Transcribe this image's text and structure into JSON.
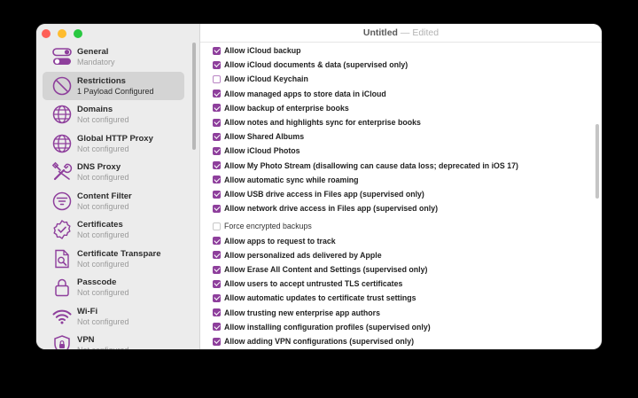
{
  "window": {
    "title": "Untitled",
    "title_sep": "—",
    "edited": "Edited"
  },
  "colors": {
    "accent": "#8e3f9c",
    "sidebar_bg": "#ececec",
    "selected_bg": "#d4d4d4"
  },
  "sidebar": {
    "items": [
      {
        "title": "General",
        "subtitle": "Mandatory",
        "icon": "toggle-icon"
      },
      {
        "title": "Restrictions",
        "subtitle": "1 Payload Configured",
        "icon": "prohibited-icon",
        "selected": true
      },
      {
        "title": "Domains",
        "subtitle": "Not configured",
        "icon": "globe-icon"
      },
      {
        "title": "Global HTTP Proxy",
        "subtitle": "Not configured",
        "icon": "globe-icon"
      },
      {
        "title": "DNS Proxy",
        "subtitle": "Not configured",
        "icon": "tools-icon"
      },
      {
        "title": "Content Filter",
        "subtitle": "Not configured",
        "icon": "filter-icon"
      },
      {
        "title": "Certificates",
        "subtitle": "Not configured",
        "icon": "certificate-badge-icon"
      },
      {
        "title": "Certificate Transpare",
        "subtitle": "Not configured",
        "icon": "document-search-icon"
      },
      {
        "title": "Passcode",
        "subtitle": "Not configured",
        "icon": "lock-icon"
      },
      {
        "title": "Wi-Fi",
        "subtitle": "Not configured",
        "icon": "wifi-icon"
      },
      {
        "title": "VPN",
        "subtitle": "Not configured",
        "icon": "vpn-icon"
      }
    ]
  },
  "options": [
    {
      "label": "Allow iCloud backup",
      "state": "on"
    },
    {
      "label": "Allow iCloud documents & data (supervised only)",
      "state": "on"
    },
    {
      "label": "Allow iCloud Keychain",
      "state": "focus"
    },
    {
      "label": "Allow managed apps to store data in iCloud",
      "state": "on"
    },
    {
      "label": "Allow backup of enterprise books",
      "state": "on"
    },
    {
      "label": "Allow notes and highlights sync for enterprise books",
      "state": "on"
    },
    {
      "label": "Allow Shared Albums",
      "state": "on"
    },
    {
      "label": "Allow iCloud Photos",
      "state": "on"
    },
    {
      "label": "Allow My Photo Stream (disallowing can cause data loss; deprecated in iOS 17)",
      "state": "on"
    },
    {
      "label": "Allow automatic sync while roaming",
      "state": "on"
    },
    {
      "label": "Allow USB drive access in Files app (supervised only)",
      "state": "on"
    },
    {
      "label": "Allow network drive access in Files app (supervised only)",
      "state": "on"
    },
    {
      "label": "Force encrypted backups",
      "state": "off"
    },
    {
      "label": "Allow apps to request to track",
      "state": "on"
    },
    {
      "label": "Allow personalized ads delivered by Apple",
      "state": "on"
    },
    {
      "label": "Allow Erase All Content and Settings (supervised only)",
      "state": "on"
    },
    {
      "label": "Allow users to accept untrusted TLS certificates",
      "state": "on"
    },
    {
      "label": "Allow automatic updates to certificate trust settings",
      "state": "on"
    },
    {
      "label": "Allow trusting new enterprise app authors",
      "state": "on"
    },
    {
      "label": "Allow installing configuration profiles (supervised only)",
      "state": "on"
    },
    {
      "label": "Allow adding VPN configurations (supervised only)",
      "state": "on"
    }
  ]
}
